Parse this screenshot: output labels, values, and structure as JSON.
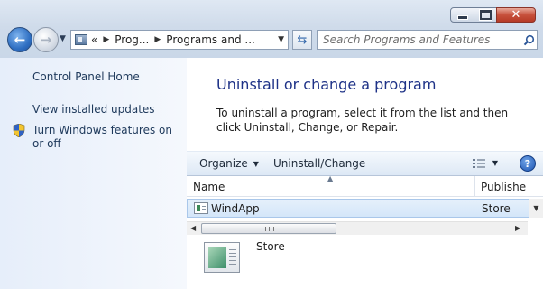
{
  "window": {
    "caption": {
      "minimize_icon": "minimize-icon",
      "maximize_icon": "maximize-icon",
      "close_icon": "close-icon"
    }
  },
  "nav": {
    "back_icon": "back-arrow-icon",
    "forward_icon": "forward-arrow-icon",
    "address": {
      "prefix": "«",
      "segments": [
        "Prog...",
        "Programs and ..."
      ]
    },
    "search": {
      "placeholder": "Search Programs and Features"
    }
  },
  "sidebar": {
    "items": [
      {
        "label": "Control Panel Home"
      },
      {
        "label": "View installed updates"
      },
      {
        "label": "Turn Windows features on or off",
        "icon": "uac-shield-icon"
      }
    ]
  },
  "main": {
    "title": "Uninstall or change a program",
    "description": "To uninstall a program, select it from the list and then click Uninstall, Change, or Repair."
  },
  "toolbar": {
    "organize_label": "Organize",
    "uninstall_label": "Uninstall/Change",
    "help_label": "?"
  },
  "list": {
    "columns": [
      "Name",
      "Publishe"
    ],
    "rows": [
      {
        "name": "WindApp",
        "publisher": "Store",
        "selected": true
      }
    ]
  },
  "details": {
    "name": "Store"
  }
}
